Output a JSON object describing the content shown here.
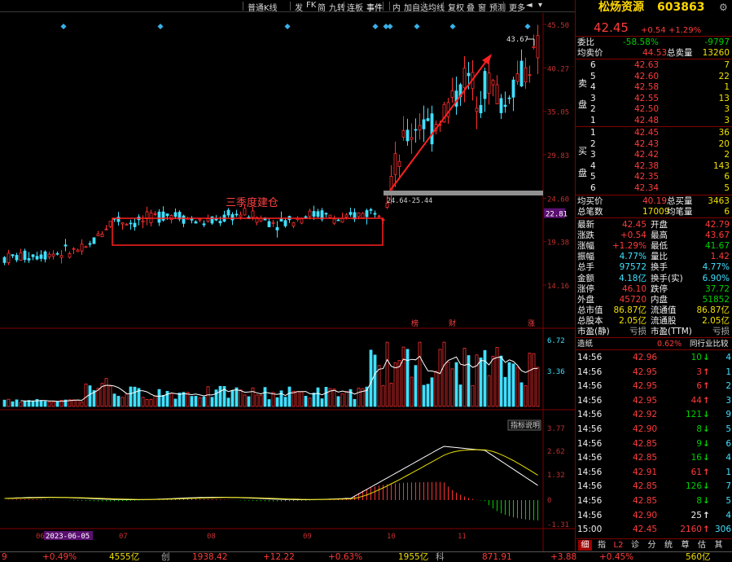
{
  "toolbar": {
    "items": [
      "普通K线",
      "发",
      "FK",
      "简",
      "九转",
      "连板",
      "事件",
      "内",
      "加自选",
      "均线",
      "复权",
      "叠",
      "窗",
      "预测",
      "更多"
    ]
  },
  "stock": {
    "name": "松炀资源",
    "code": "603863",
    "price": "42.45",
    "change": "+0.54",
    "change_pct": "+1.29%"
  },
  "order_book": {
    "weibi_label": "委比",
    "weibi": "-58.58%",
    "weicha": "-9797",
    "avg_sell_label": "均卖价",
    "avg_sell": "44.53",
    "total_sell_label": "总卖量",
    "total_sell": "13260",
    "sell_side_label": [
      "卖",
      "盘"
    ],
    "asks": [
      {
        "level": "6",
        "price": "42.63",
        "vol": "7"
      },
      {
        "level": "5",
        "price": "42.60",
        "vol": "22"
      },
      {
        "level": "4",
        "price": "42.58",
        "vol": "1"
      },
      {
        "level": "3",
        "price": "42.55",
        "vol": "13"
      },
      {
        "level": "2",
        "price": "42.50",
        "vol": "3"
      },
      {
        "level": "1",
        "price": "42.48",
        "vol": "3"
      }
    ],
    "buy_side_label": [
      "买",
      "盘"
    ],
    "bids": [
      {
        "level": "1",
        "price": "42.45",
        "vol": "36"
      },
      {
        "level": "2",
        "price": "42.43",
        "vol": "20"
      },
      {
        "level": "3",
        "price": "42.42",
        "vol": "2"
      },
      {
        "level": "4",
        "price": "42.38",
        "vol": "143"
      },
      {
        "level": "5",
        "price": "42.35",
        "vol": "6"
      },
      {
        "level": "6",
        "price": "42.34",
        "vol": "5"
      }
    ],
    "avg_buy_label": "均买价",
    "avg_buy": "40.19",
    "total_buy_label": "总买量",
    "total_buy": "3463",
    "total_count_label": "总笔数",
    "total_count": "17009",
    "avg_count_label": "均笔量",
    "avg_count": "6"
  },
  "quote_stats": [
    {
      "l1": "最新",
      "v1": "42.45",
      "c1": "red",
      "l2": "开盘",
      "v2": "42.79",
      "c2": "red"
    },
    {
      "l1": "涨跌",
      "v1": "+0.54",
      "c1": "red",
      "l2": "最高",
      "v2": "43.67",
      "c2": "red"
    },
    {
      "l1": "涨幅",
      "v1": "+1.29%",
      "c1": "red",
      "l2": "最低",
      "v2": "41.67",
      "c2": "green"
    },
    {
      "l1": "振幅",
      "v1": "4.77%",
      "c1": "cyan",
      "l2": "量比",
      "v2": "1.42",
      "c2": "red"
    },
    {
      "l1": "总手",
      "v1": "97572",
      "c1": "cyan",
      "l2": "换手",
      "v2": "4.77%",
      "c2": "cyan"
    },
    {
      "l1": "金额",
      "v1": "4.18亿",
      "c1": "cyan",
      "l2": "换手(实)",
      "v2": "6.90%",
      "c2": "cyan"
    },
    {
      "l1": "涨停",
      "v1": "46.10",
      "c1": "red",
      "l2": "跌停",
      "v2": "37.72",
      "c2": "green"
    },
    {
      "l1": "外盘",
      "v1": "45720",
      "c1": "red",
      "l2": "内盘",
      "v2": "51852",
      "c2": "green"
    },
    {
      "l1": "总市值",
      "v1": "86.87亿",
      "c1": "yellow",
      "l2": "流通值",
      "v2": "86.87亿",
      "c2": "yellow"
    },
    {
      "l1": "总股本",
      "v1": "2.05亿",
      "c1": "yellow",
      "l2": "流通股",
      "v2": "2.05亿",
      "c2": "yellow"
    },
    {
      "l1": "市盈(静)",
      "v1": "亏损",
      "c1": "gray",
      "l2": "市盈(TTM)",
      "v2": "亏损",
      "c2": "gray"
    }
  ],
  "sector": {
    "name": "造纸",
    "pct": "0.62%",
    "ranking_label": "同行业比较"
  },
  "ticks": [
    {
      "time": "14:56",
      "price": "42.96",
      "vol": "10",
      "dir": "down",
      "n": "4"
    },
    {
      "time": "14:56",
      "price": "42.95",
      "vol": "3",
      "dir": "up",
      "n": "1"
    },
    {
      "time": "14:56",
      "price": "42.95",
      "vol": "6",
      "dir": "up",
      "n": "2"
    },
    {
      "time": "14:56",
      "price": "42.95",
      "vol": "44",
      "dir": "up",
      "n": "3"
    },
    {
      "time": "14:56",
      "price": "42.92",
      "vol": "121",
      "dir": "down",
      "n": "9"
    },
    {
      "time": "14:56",
      "price": "42.90",
      "vol": "8",
      "dir": "down",
      "n": "5"
    },
    {
      "time": "14:56",
      "price": "42.85",
      "vol": "9",
      "dir": "down",
      "n": "6"
    },
    {
      "time": "14:56",
      "price": "42.85",
      "vol": "16",
      "dir": "down",
      "n": "4"
    },
    {
      "time": "14:56",
      "price": "42.91",
      "vol": "61",
      "dir": "up",
      "n": "1"
    },
    {
      "time": "14:56",
      "price": "42.85",
      "vol": "126",
      "dir": "down",
      "n": "7"
    },
    {
      "time": "14:56",
      "price": "42.85",
      "vol": "8",
      "dir": "down",
      "n": "5"
    },
    {
      "time": "14:56",
      "price": "42.90",
      "vol": "25",
      "dir": "flat",
      "n": "4"
    },
    {
      "time": "15:00",
      "price": "42.45",
      "vol": "2160",
      "dir": "up",
      "n": "306"
    }
  ],
  "bottom_tabs": [
    "细",
    "指",
    "L2",
    "诊",
    "分",
    "统",
    "尊",
    "估",
    "其"
  ],
  "statusbar": [
    {
      "text": "9",
      "color": "red"
    },
    {
      "text": "+0.49%",
      "color": "red"
    },
    {
      "text": "4555亿",
      "color": "yellow"
    },
    {
      "text": "创",
      "color": "gray"
    },
    {
      "text": "1938.42",
      "color": "red"
    },
    {
      "text": "+12.22",
      "color": "red"
    },
    {
      "text": "+0.63%",
      "color": "red"
    },
    {
      "text": "1955亿",
      "color": "yellow"
    },
    {
      "text": "科",
      "color": "gray"
    },
    {
      "text": "871.91",
      "color": "red"
    },
    {
      "text": "+3.88",
      "color": "red"
    },
    {
      "text": "+0.45%",
      "color": "red"
    },
    {
      "text": "560亿",
      "color": "yellow"
    }
  ],
  "chart_data": {
    "type": "candlestick",
    "price_axis": [
      "45.50",
      "40.27",
      "35.05",
      "29.83",
      "24.60",
      "19.38",
      "14.16"
    ],
    "last_price_tag": "22.81",
    "volume_axis": [
      "6.72",
      "3.36"
    ],
    "macd_axis": [
      "3.77",
      "2.62",
      "1.32",
      "0",
      "-1.31"
    ],
    "macd_button": "指标说明",
    "x_labels": [
      "06",
      "2023-06-05",
      "07",
      "08",
      "09",
      "10",
      "11"
    ],
    "markers": [
      "榜",
      "财",
      "涨"
    ],
    "annotations": {
      "box_label": "三季度建仓",
      "high_label": "43.67",
      "range_label": "24.64-25.44"
    }
  }
}
